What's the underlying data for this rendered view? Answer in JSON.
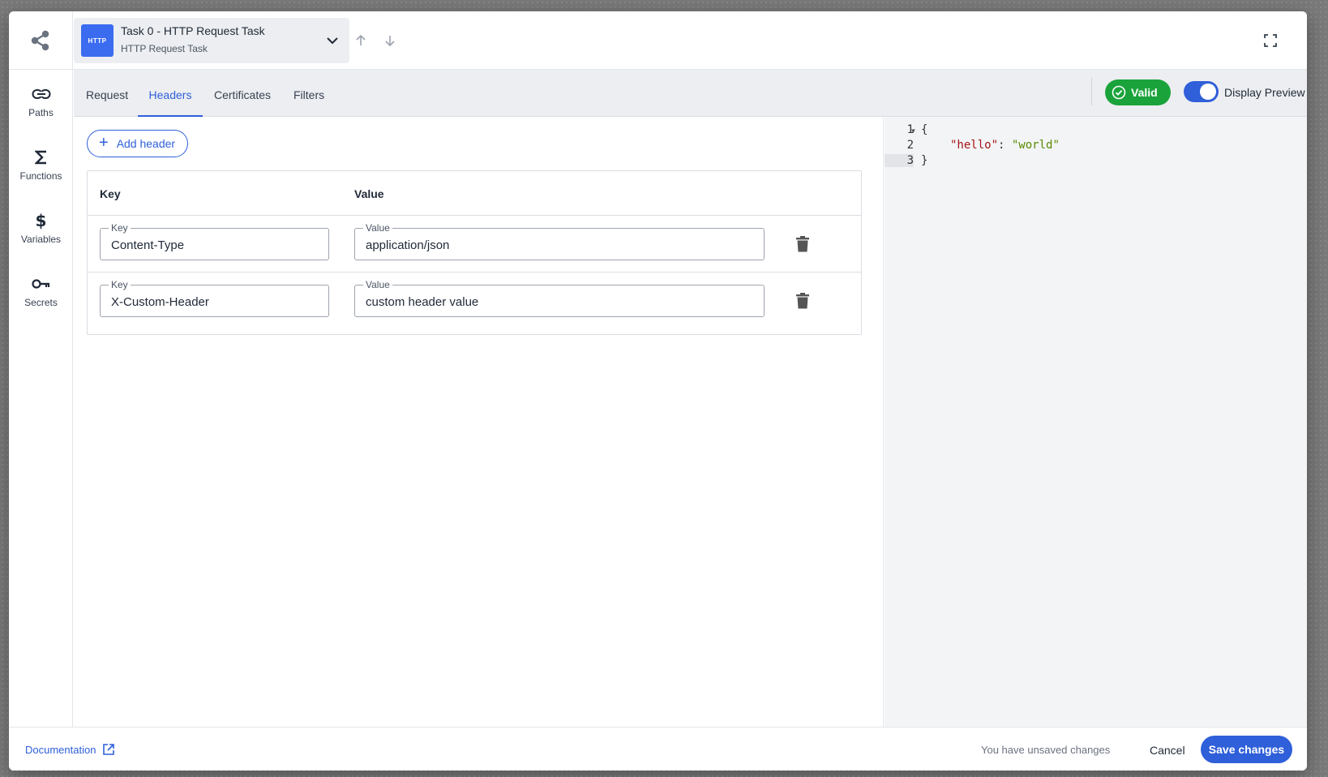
{
  "task": {
    "badge": "HTTP",
    "title": "Task 0 - HTTP Request Task",
    "subtitle": "HTTP Request Task"
  },
  "sidenav": {
    "items": [
      {
        "label": "Paths",
        "icon": "link-icon"
      },
      {
        "label": "Functions",
        "icon": "sigma-icon"
      },
      {
        "label": "Variables",
        "icon": "dollar-icon"
      },
      {
        "label": "Secrets",
        "icon": "key-icon"
      }
    ]
  },
  "tabs": [
    {
      "label": "Request"
    },
    {
      "label": "Headers",
      "active": true
    },
    {
      "label": "Certificates"
    },
    {
      "label": "Filters"
    }
  ],
  "status": {
    "valid_label": "Valid",
    "toggle_label": "Display Preview",
    "toggle_on": true
  },
  "headers": {
    "add_label": "Add header",
    "col_key": "Key",
    "col_value": "Value",
    "field_key_label": "Key",
    "field_value_label": "Value",
    "rows": [
      {
        "key": "Content-Type",
        "value": "application/json"
      },
      {
        "key": "X-Custom-Header",
        "value": "custom header value"
      }
    ]
  },
  "preview": {
    "lines": [
      {
        "n": "1",
        "open": "{"
      },
      {
        "n": "2",
        "key": "\"hello\"",
        "sep": ": ",
        "val": "\"world\""
      },
      {
        "n": "3",
        "close": "}"
      }
    ]
  },
  "footer": {
    "doc_label": "Documentation",
    "unsaved_text": "You have unsaved changes",
    "cancel_label": "Cancel",
    "save_label": "Save changes"
  },
  "colors": {
    "accent": "#2f5fd9",
    "valid": "#1aa33a",
    "badge": "#3b6cf0"
  }
}
